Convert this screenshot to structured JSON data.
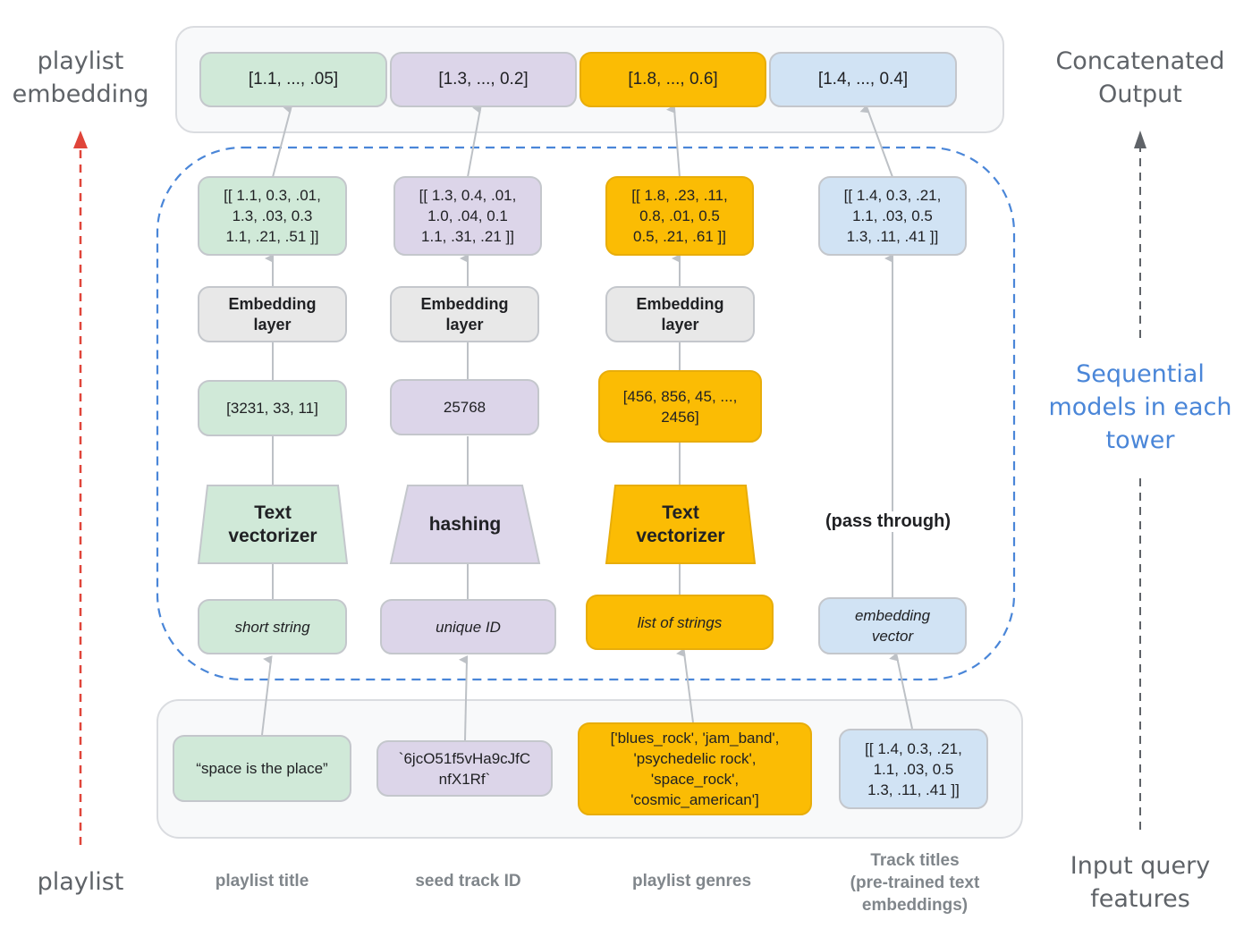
{
  "side_labels": {
    "top_left": "playlist\nembedding",
    "bottom_left": "playlist",
    "top_right": "Concatenated\nOutput",
    "middle_right": "Sequential\nmodels in each\ntower",
    "bottom_right": "Input query\nfeatures"
  },
  "colors": {
    "green": "#d0e9d8",
    "purple": "#dcd5e9",
    "yellow": "#fbbc04",
    "blue": "#d1e3f4",
    "grey": "#e8e8e8",
    "dashed_border": "#4a86d8",
    "playlist_arrow": "#e0453a",
    "output_arrow": "#5f6368"
  },
  "towers": [
    {
      "name": "playlist-title",
      "feature_label": "playlist title",
      "input_example": "“space is the place”",
      "input_type": "short string",
      "preprocessor": "Text\nvectorizer",
      "tokens": "[3231, 33, 11]",
      "embedding_layer": "Embedding\nlayer",
      "embedding_matrix": "[[ 1.1, 0.3,  .01,\n1.3, .03, 0.3\n1.1, .21,  .51 ]]",
      "output_vector": "[1.1, ..., .05]"
    },
    {
      "name": "seed-track-id",
      "feature_label": "seed track ID",
      "input_example": "`6jcO51f5vHa9cJfC\nnfX1Rf`",
      "input_type": "unique ID",
      "preprocessor": "hashing",
      "tokens": "25768",
      "embedding_layer": "Embedding\nlayer",
      "embedding_matrix": "[[ 1.3, 0.4,  .01,\n1.0, .04, 0.1\n1.1, .31,  .21 ]]",
      "output_vector": "[1.3, ..., 0.2]"
    },
    {
      "name": "playlist-genres",
      "feature_label": "playlist genres",
      "input_example": "['blues_rock', 'jam_band',\n'psychedelic rock',\n'space_rock',\n'cosmic_american']",
      "input_type": "list of strings",
      "preprocessor": "Text\nvectorizer",
      "tokens": "[456, 856, 45, ...,\n2456]",
      "embedding_layer": "Embedding\nlayer",
      "embedding_matrix": "[[ 1.8, .23,  .11,\n0.8, .01, 0.5\n0.5, .21,  .61 ]]",
      "output_vector": "[1.8, ..., 0.6]"
    },
    {
      "name": "track-titles",
      "feature_label": "Track titles\n(pre-trained text\nembeddings)",
      "input_example": "[[ 1.4, 0.3,  .21,\n1.1, .03, 0.5\n1.3, .11,  .41 ]]",
      "input_type": "embedding\nvector",
      "preprocessor": "(pass through)",
      "embedding_matrix": "[[ 1.4, 0.3,  .21,\n1.1, .03, 0.5\n1.3, .11,  .41 ]]",
      "output_vector": "[1.4, ..., 0.4]"
    }
  ]
}
